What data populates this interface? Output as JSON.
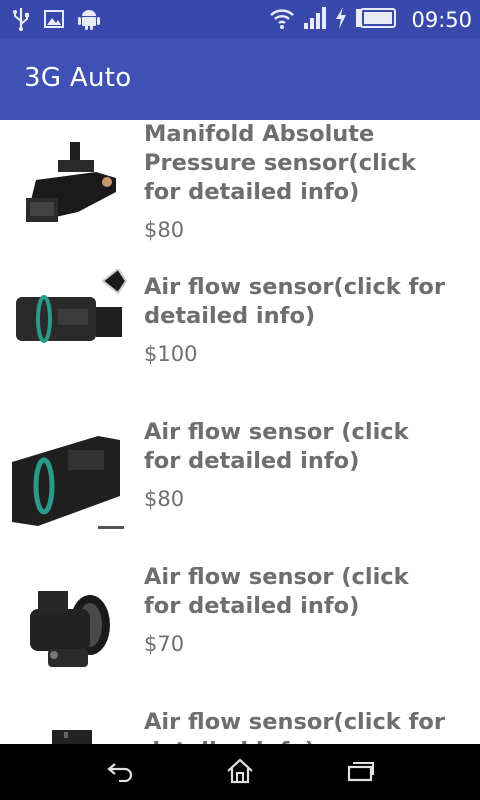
{
  "status_bar": {
    "time": "09:50",
    "icons": [
      "usb-icon",
      "image-icon",
      "android-icon",
      "wifi-icon",
      "signal-icon",
      "charging-icon",
      "battery-icon"
    ]
  },
  "app_bar": {
    "title": "3G Auto"
  },
  "products": [
    {
      "name": "Manifold Absolute Pressure sensor(click for detailed info)",
      "price": "$80",
      "image": "map-sensor"
    },
    {
      "name": "Air flow sensor(click for detailed info)",
      "price": "$100",
      "image": "air-flow-sensor"
    },
    {
      "name": "Air flow sensor (click for detailed info)",
      "price": "$80",
      "image": "air-flow-sensor"
    },
    {
      "name": "Air flow sensor (click for detailed info)",
      "price": "$70",
      "image": "air-flow-housing"
    },
    {
      "name": "Air flow sensor(click for detailed info)",
      "price": "",
      "image": "air-flow-sensor"
    }
  ],
  "nav_bar": {
    "icons": [
      "back-icon",
      "home-icon",
      "recent-apps-icon"
    ]
  },
  "colors": {
    "status_bar": "#3949ab",
    "app_bar": "#3f51b5",
    "text_gray": "#6e6e6e",
    "nav_bar": "#000000"
  }
}
